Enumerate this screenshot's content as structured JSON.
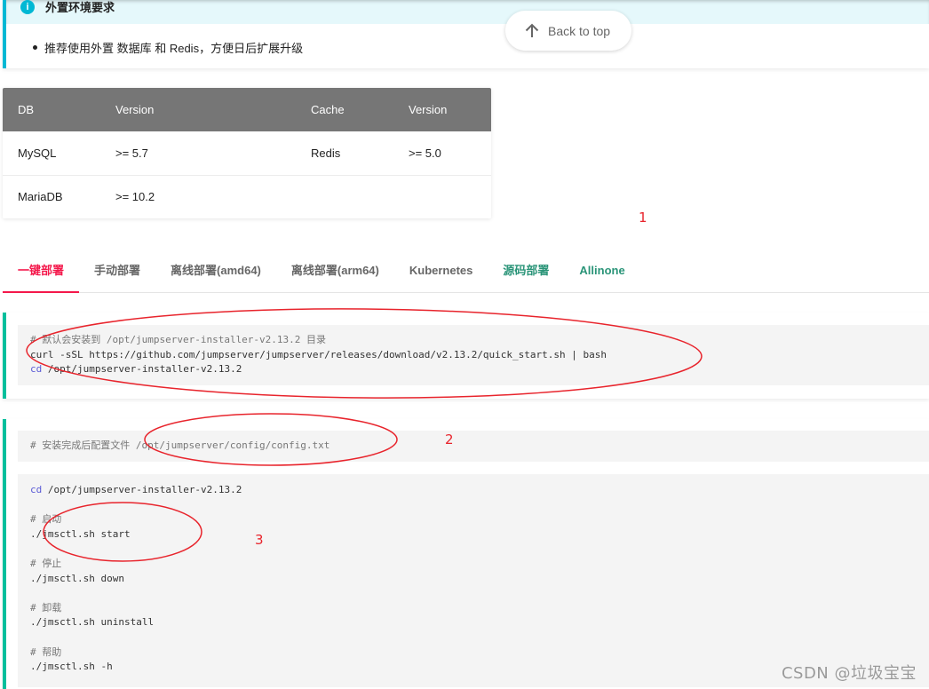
{
  "admonition": {
    "icon": "info-icon",
    "title": "外置环境要求",
    "items": [
      "推荐使用外置 数据库 和 Redis，方便日后扩展升级"
    ]
  },
  "back_to_top": {
    "label": "Back to top",
    "icon": "arrow-up-icon"
  },
  "requirements_table": {
    "headers": [
      "DB",
      "Version",
      "Cache",
      "Version"
    ],
    "rows": [
      [
        "MySQL",
        ">= 5.7",
        "Redis",
        ">= 5.0"
      ],
      [
        "MariaDB",
        ">= 10.2",
        "",
        ""
      ]
    ]
  },
  "annotations": [
    "1",
    "2",
    "3"
  ],
  "tabs": [
    {
      "label": "一键部署",
      "state": "active"
    },
    {
      "label": "手动部署",
      "state": "normal"
    },
    {
      "label": "离线部署(amd64)",
      "state": "normal"
    },
    {
      "label": "离线部署(arm64)",
      "state": "normal"
    },
    {
      "label": "Kubernetes",
      "state": "normal"
    },
    {
      "label": "源码部署",
      "state": "link"
    },
    {
      "label": "Allinone",
      "state": "link"
    }
  ],
  "code_block_1": {
    "comment": "# 默认会安装到 /opt/jumpserver-installer-v2.13.2 目录",
    "line2": "curl -sSL https://github.com/jumpserver/jumpserver/releases/download/v2.13.2/quick_start.sh | bash",
    "line3_kw": "cd",
    "line3_rest": " /opt/jumpserver-installer-v2.13.2"
  },
  "code_block_2": {
    "comment": "# 安装完成后配置文件 /opt/jumpserver/config/config.txt"
  },
  "code_block_3": {
    "cd_kw": "cd",
    "cd_rest": " /opt/jumpserver-installer-v2.13.2",
    "c_start": "# 启动",
    "start": "./jmsctl.sh start",
    "c_stop": "# 停止",
    "stop": "./jmsctl.sh down",
    "c_uninstall": "# 卸载",
    "uninstall": "./jmsctl.sh uninstall",
    "c_help": "# 帮助",
    "help": "./jmsctl.sh -h"
  },
  "colors": {
    "info": "#00b8d4",
    "tab_active": "#f4184b",
    "tab_link": "#2a9478",
    "card_accent": "#00bf9c",
    "annotation": "#e8242c",
    "table_header": "#767676"
  },
  "watermark": "CSDN @垃圾宝宝"
}
